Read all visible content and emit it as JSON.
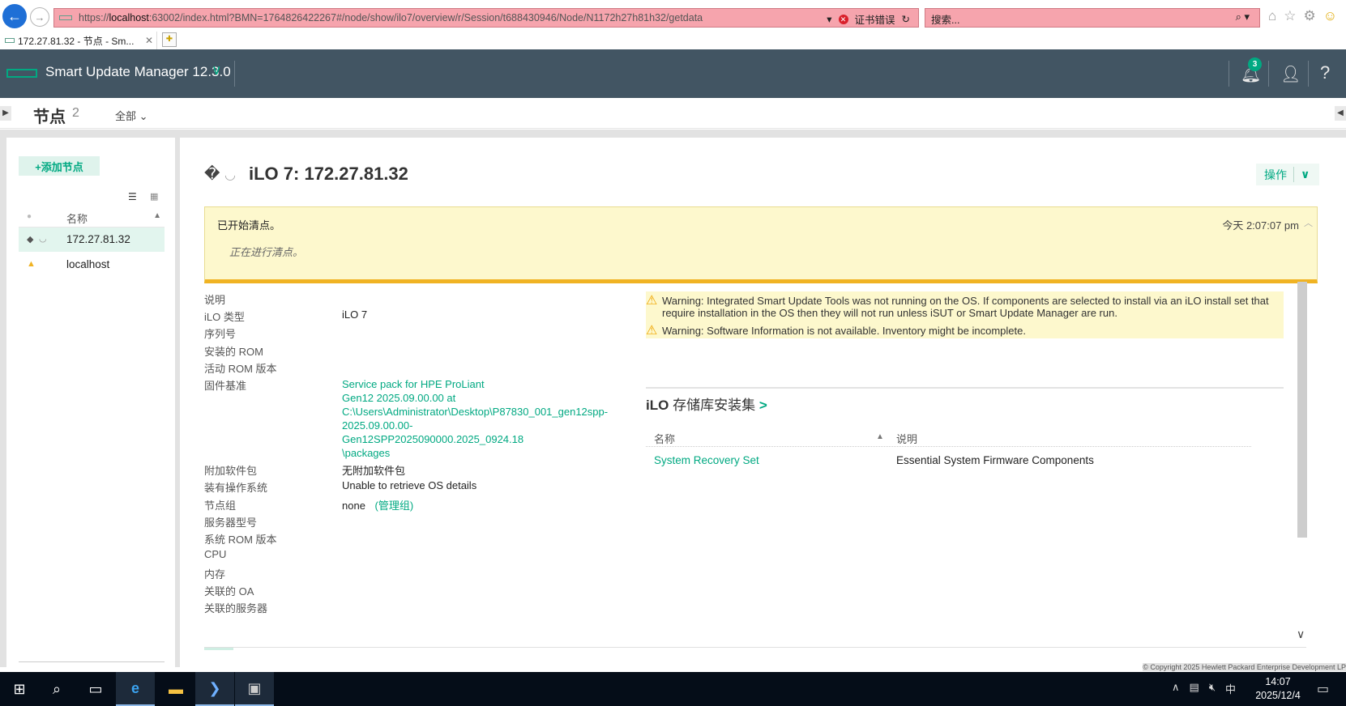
{
  "browser": {
    "url_prefix": "https://",
    "url_host": "localhost",
    "url_rest": ":63002/index.html?BMN=1764826422267#/node/show/ilo7/overview/r/Session/t688430946/Node/N1172h27h81h32/getdata",
    "cert_error": "证书错误",
    "search_placeholder": "搜索...",
    "tab_title": "172.27.81.32 - 节点 - Sm..."
  },
  "app": {
    "name": "Smart Update Manager 12.3.0",
    "notification_count": "3"
  },
  "page": {
    "title": "节点",
    "count": "2",
    "filter": "全部"
  },
  "sidebar": {
    "add_node": "+添加节点",
    "column_name": "名称",
    "nodes": [
      {
        "label": "172.27.81.32"
      },
      {
        "label": "localhost"
      }
    ]
  },
  "node": {
    "title": "iLO 7: 172.27.81.32",
    "actions": "操作"
  },
  "notice": {
    "title": "已开始清点。",
    "message": "正在进行清点。",
    "time": "今天 2:07:07 pm"
  },
  "properties": [
    {
      "label": "说明",
      "value": ""
    },
    {
      "label": "iLO 类型",
      "value": "iLO 7"
    },
    {
      "label": "序列号",
      "value": ""
    },
    {
      "label": "安装的 ROM",
      "value": ""
    },
    {
      "label": "活动 ROM 版本",
      "value": ""
    },
    {
      "label": "固件基准",
      "value": "Service pack for HPE ProLiant Gen12 2025.09.00.00 at C:\\Users\\Administrator\\Desktop\\P87830_001_gen12spp-2025.09.00.00-Gen12SPP2025090000.2025_0924.18\\packages"
    },
    {
      "label": "附加软件包",
      "value": "无附加软件包"
    },
    {
      "label": "装有操作系统",
      "value": "Unable to retrieve OS details"
    },
    {
      "label": "节点组",
      "value": "none",
      "link": "(管理组)"
    },
    {
      "label": "服务器型号",
      "value": ""
    },
    {
      "label": "系统 ROM 版本",
      "value": ""
    },
    {
      "label": "CPU",
      "value": ""
    },
    {
      "label": "内存",
      "value": ""
    },
    {
      "label": "关联的 OA",
      "value": ""
    },
    {
      "label": "关联的服务器",
      "value": ""
    }
  ],
  "baseline_lines": [
    "Service pack for HPE ProLiant",
    "Gen12 2025.09.00.00 at",
    "C:\\Users\\Administrator\\Desktop\\P87830_001_gen12spp-",
    "2025.09.00.00-",
    "Gen12SPP2025090000.2025_0924.18",
    "\\packages"
  ],
  "warnings": [
    "Warning: Integrated Smart Update Tools was not running on the OS. If components are selected to install via an iLO install set that require installation in the OS then they will not run unless iSUT or Smart Update Manager are run.",
    "Warning: Software Information is not available. Inventory might be incomplete."
  ],
  "repo": {
    "title_prefix": "iLO",
    "title_rest": " 存储库安装集",
    "arrow": ">",
    "col_name": "名称",
    "col_desc": "说明",
    "rows": [
      {
        "name": "System Recovery Set",
        "desc": "Essential System Firmware Components"
      }
    ]
  },
  "footer": {
    "copyright": "© Copyright 2025 Hewlett Packard Enterprise Development LP"
  },
  "taskbar": {
    "time": "14:07",
    "date": "2025/12/4",
    "ime": "中"
  },
  "colors": {
    "accent": "#01a982",
    "header": "#425563",
    "notice_bg": "#fdf8cd",
    "notice_border": "#f0b323",
    "address_error": "#f6a4ad"
  }
}
